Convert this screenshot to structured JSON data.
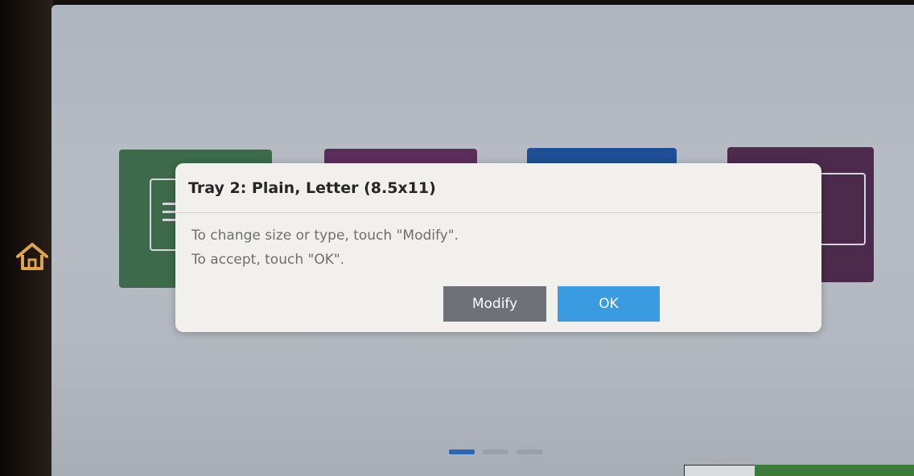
{
  "dialog": {
    "title": "Tray 2: Plain, Letter (8.5x11)",
    "message_line1": "To change size or type, touch \"Modify\".",
    "message_line2": "To accept, touch \"OK\".",
    "modify_label": "Modify",
    "ok_label": "OK"
  },
  "colors": {
    "ok_button": "#3b9be0",
    "modify_button": "#6e7177",
    "home_icon": "#e0a24a",
    "active_page_dot": "#2a66b8"
  },
  "icons": {
    "home": "home-icon"
  },
  "pager": {
    "pages": 3,
    "active_index": 0
  }
}
